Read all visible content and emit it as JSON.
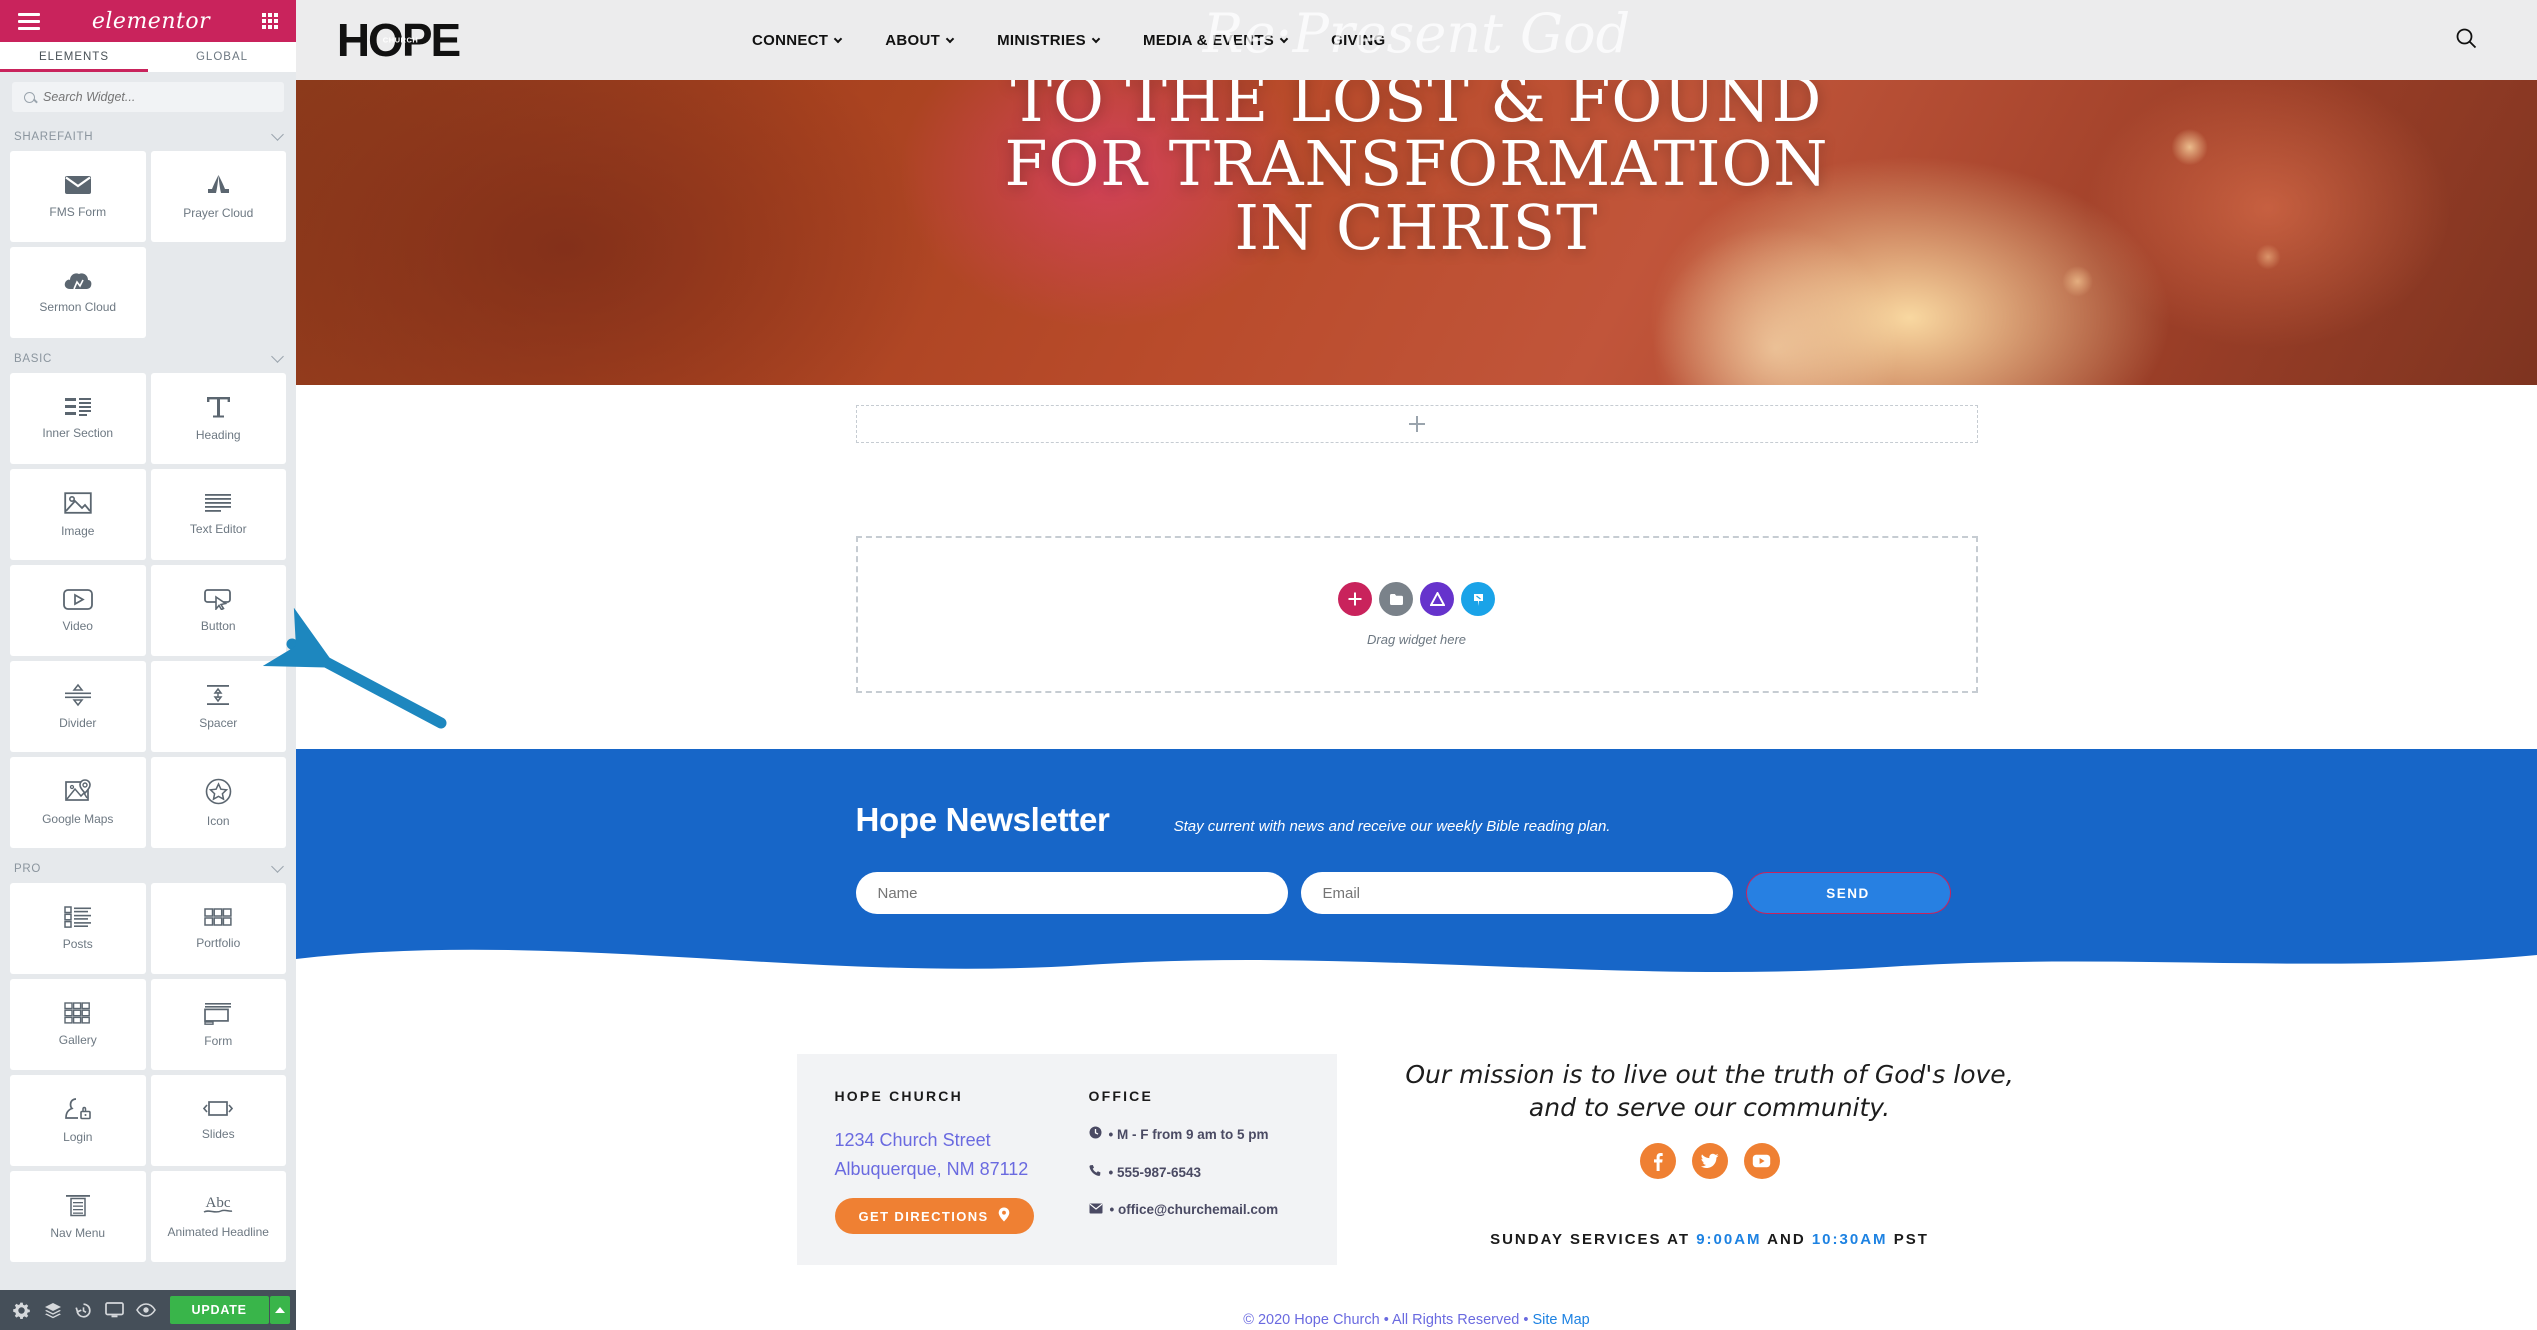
{
  "panel": {
    "logo_text": "elementor",
    "tabs": [
      {
        "label": "ELEMENTS",
        "active": true
      },
      {
        "label": "GLOBAL",
        "active": false
      }
    ],
    "search": {
      "placeholder": "Search Widget..."
    },
    "categories": [
      {
        "name": "SHAREFAITH",
        "widgets": [
          {
            "label": "FMS Form",
            "icon": "envelope-icon"
          },
          {
            "label": "Prayer Cloud",
            "icon": "praying-hands-icon"
          },
          {
            "label": "Sermon Cloud",
            "icon": "cloud-icon"
          }
        ]
      },
      {
        "name": "BASIC",
        "widgets": [
          {
            "label": "Inner Section",
            "icon": "columns-icon"
          },
          {
            "label": "Heading",
            "icon": "heading-t-icon"
          },
          {
            "label": "Image",
            "icon": "image-icon"
          },
          {
            "label": "Text Editor",
            "icon": "text-lines-icon"
          },
          {
            "label": "Video",
            "icon": "play-icon"
          },
          {
            "label": "Button",
            "icon": "button-cursor-icon"
          },
          {
            "label": "Divider",
            "icon": "divider-icon"
          },
          {
            "label": "Spacer",
            "icon": "spacer-arrows-icon"
          },
          {
            "label": "Google Maps",
            "icon": "map-pin-icon"
          },
          {
            "label": "Icon",
            "icon": "star-circle-icon"
          }
        ]
      },
      {
        "name": "PRO",
        "widgets": [
          {
            "label": "Posts",
            "icon": "posts-list-icon"
          },
          {
            "label": "Portfolio",
            "icon": "portfolio-grid-icon"
          },
          {
            "label": "Gallery",
            "icon": "gallery-grid-icon"
          },
          {
            "label": "Form",
            "icon": "form-screen-icon"
          },
          {
            "label": "Login",
            "icon": "user-lock-icon"
          },
          {
            "label": "Slides",
            "icon": "slides-arrows-icon"
          },
          {
            "label": "Nav Menu",
            "icon": "nav-menu-icon"
          },
          {
            "label": "Animated Headline",
            "icon": "abc-underline-icon"
          }
        ]
      }
    ],
    "footer": {
      "icons": [
        "gear-icon",
        "layers-icon",
        "history-icon",
        "responsive-monitor-icon",
        "preview-eye-icon"
      ],
      "update_label": "UPDATE",
      "caret": "caret-up-icon"
    }
  },
  "site": {
    "logo": {
      "main": "HOPE",
      "sub": "CHURCH"
    },
    "nav": [
      {
        "label": "CONNECT",
        "has_dropdown": true
      },
      {
        "label": "ABOUT",
        "has_dropdown": true
      },
      {
        "label": "MINISTRIES",
        "has_dropdown": true
      },
      {
        "label": "MEDIA & EVENTS",
        "has_dropdown": true
      },
      {
        "label": "GIVING",
        "has_dropdown": false
      }
    ],
    "search_icon": "search-icon",
    "watermark": "Re·Present God",
    "hero": {
      "line1": "TO THE LOST & FOUND",
      "line2": "FOR TRANSFORMATION",
      "line3": "IN CHRIST"
    }
  },
  "editor": {
    "add_section_icon": "plus-icon",
    "drop_zone": {
      "label": "Drag widget here",
      "buttons": [
        {
          "icon": "plus-icon",
          "color": "#c9235c"
        },
        {
          "icon": "folder-icon",
          "color": "#7a828a"
        },
        {
          "icon": "triangle-icon",
          "color": "#6633cc"
        },
        {
          "icon": "pin-icon",
          "color": "#1aa3e8"
        }
      ]
    }
  },
  "newsletter": {
    "title": "Hope Newsletter",
    "subtitle": "Stay current with news and receive our weekly Bible reading plan.",
    "name_placeholder": "Name",
    "email_placeholder": "Email",
    "send_label": "SEND",
    "bg_color": "#1766c8"
  },
  "footer": {
    "contact": {
      "church_heading": "HOPE CHURCH",
      "address_line1": "1234 Church Street",
      "address_line2": "Albuquerque, NM 87112",
      "directions_label": "GET DIRECTIONS",
      "directions_icon": "map-pin-icon",
      "office_heading": "OFFICE",
      "hours": "• M - F from 9 am to 5 pm",
      "hours_icon": "clock-icon",
      "phone": "• 555-987-6543",
      "phone_icon": "phone-icon",
      "email": "• office@churchemail.com",
      "email_icon": "envelope-icon"
    },
    "mission_line1": "Our mission is to live out the truth of God's love,",
    "mission_line2": "and to serve our community.",
    "socials": [
      {
        "name": "facebook-icon"
      },
      {
        "name": "twitter-icon"
      },
      {
        "name": "youtube-icon"
      }
    ],
    "services_prefix": "SUNDAY SERVICES AT ",
    "services_time1": "9:00AM",
    "services_mid": " AND ",
    "services_time2": "10:30AM",
    "services_suffix": " PST",
    "copyright": "© 2020 Hope Church • All Rights Reserved • ",
    "sitemap": "Site Map",
    "accent_orange": "#ef8033",
    "accent_blue": "#1d82e2",
    "link_purple": "#6a6ae0"
  },
  "annotation": {
    "arrow_color": "#1d87bf",
    "points_at": "Button"
  }
}
